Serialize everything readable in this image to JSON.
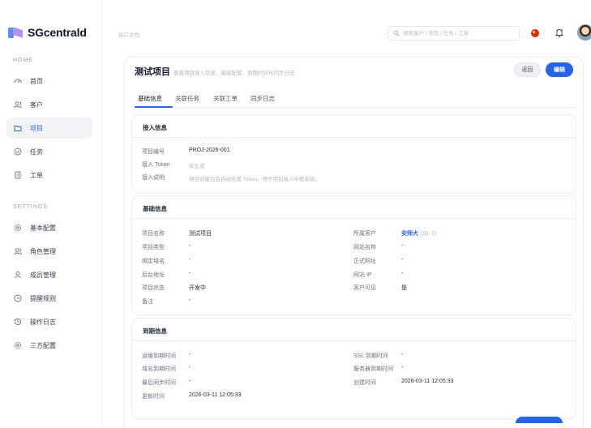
{
  "app": {
    "logo_text": "SGcentrald"
  },
  "sidebar": {
    "section_home": "HOME",
    "section_settings": "SETTINGS",
    "items": [
      {
        "label": "首页",
        "icon": "dashboard-icon"
      },
      {
        "label": "客户",
        "icon": "users-icon"
      },
      {
        "label": "项目",
        "icon": "folder-icon",
        "active": true
      },
      {
        "label": "任务",
        "icon": "check-circle-icon"
      },
      {
        "label": "工单",
        "icon": "document-icon"
      }
    ],
    "settings_items": [
      {
        "label": "基本配置",
        "icon": "gear-icon"
      },
      {
        "label": "角色管理",
        "icon": "users-icon"
      },
      {
        "label": "成员管理",
        "icon": "user-icon"
      },
      {
        "label": "提醒规则",
        "icon": "clock-icon"
      },
      {
        "label": "操作日志",
        "icon": "history-icon"
      },
      {
        "label": "三方配置",
        "icon": "gear-icon"
      }
    ]
  },
  "header": {
    "breadcrumb": "接口文档",
    "search_placeholder": "搜索客户 / 项目 / 任务 / 工单"
  },
  "page": {
    "title": "测试项目",
    "subtitle": "查看项目接入信息、基础配置、到期时间与同步日志",
    "back_label": "返回",
    "edit_label": "编辑"
  },
  "tabs": [
    "基础信息",
    "关联任务",
    "关联工单",
    "同步日志"
  ],
  "access": {
    "title": "接入信息",
    "rows": [
      {
        "label": "项目编号",
        "value": "PROJ-2026-001"
      },
      {
        "label": "接入 Token",
        "value": "未生成"
      },
      {
        "label": "接入说明",
        "value": "项目创建后会自动生成 Token，用于项目接入中枢系统。"
      }
    ]
  },
  "basic": {
    "title": "基础信息",
    "left": [
      {
        "label": "项目名称",
        "value": "测试项目"
      },
      {
        "label": "项目类型",
        "value": "-"
      },
      {
        "label": "绑定域名",
        "value": "-"
      },
      {
        "label": "后台地址",
        "value": "-"
      },
      {
        "label": "项目状态",
        "value": "开发中"
      },
      {
        "label": "备注",
        "value": "-"
      }
    ],
    "right": [
      {
        "label": "所属客户",
        "value": "安师大",
        "hint": "(ID: 2)"
      },
      {
        "label": "网站名称",
        "value": "-"
      },
      {
        "label": "正式网址",
        "value": "-"
      },
      {
        "label": "网站 IP",
        "value": "-"
      },
      {
        "label": "客户可见",
        "value": "是"
      }
    ]
  },
  "expiry": {
    "title": "到期信息",
    "left": [
      {
        "label": "运维到期时间",
        "value": "-"
      },
      {
        "label": "域名到期时间",
        "value": "-"
      },
      {
        "label": "最后同步时间",
        "value": "-"
      },
      {
        "label": "更新时间",
        "value": "2026-03-11 12:05:33"
      }
    ],
    "right": [
      {
        "label": "SSL 到期时间",
        "value": "-"
      },
      {
        "label": "服务器到期时间",
        "value": "-"
      },
      {
        "label": "创建时间",
        "value": "2026-03-11 12:05:33"
      }
    ]
  },
  "colors": {
    "accent": "#2563eb",
    "flag": "#de2910"
  }
}
